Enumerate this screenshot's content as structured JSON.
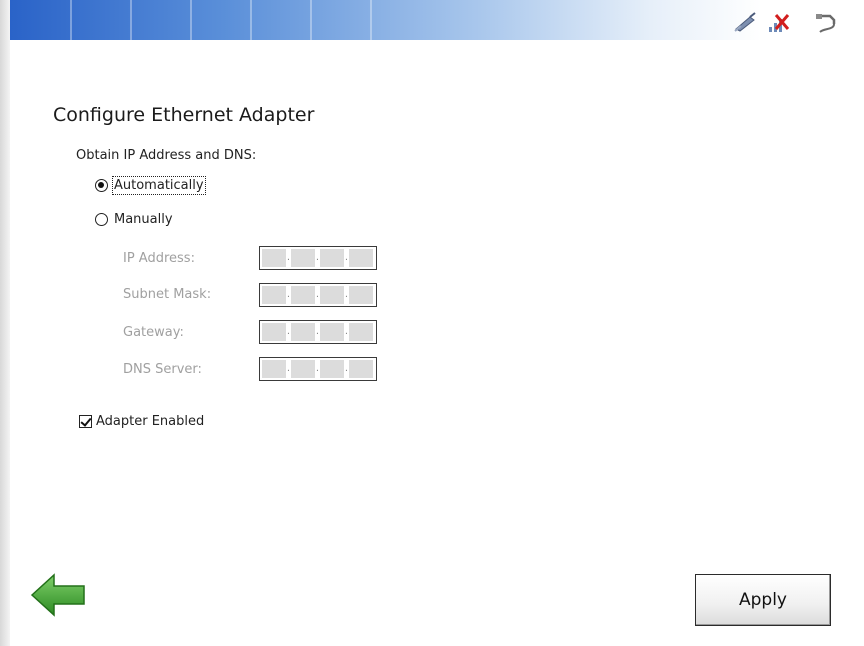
{
  "header": {
    "tray_icons": [
      "network-cable-icon",
      "wireless-disconnected-icon",
      "power-plug-icon"
    ]
  },
  "page": {
    "title": "Configure Ethernet Adapter",
    "section_label": "Obtain IP Address and DNS:"
  },
  "ip_mode": {
    "options": [
      {
        "label": "Automatically",
        "selected": true
      },
      {
        "label": "Manually",
        "selected": false
      }
    ]
  },
  "fields": [
    {
      "label": "IP Address:",
      "value": ""
    },
    {
      "label": "Subnet Mask:",
      "value": ""
    },
    {
      "label": "Gateway:",
      "value": ""
    },
    {
      "label": "DNS Server:",
      "value": ""
    }
  ],
  "adapter": {
    "enabled_label": "Adapter Enabled",
    "enabled": true
  },
  "footer": {
    "back_icon": "back-arrow-icon",
    "apply_label": "Apply"
  },
  "colors": {
    "header_gradient_start": "#2a63c8",
    "back_arrow": "#3c9a2c",
    "disabled_text": "#a0a0a0"
  }
}
